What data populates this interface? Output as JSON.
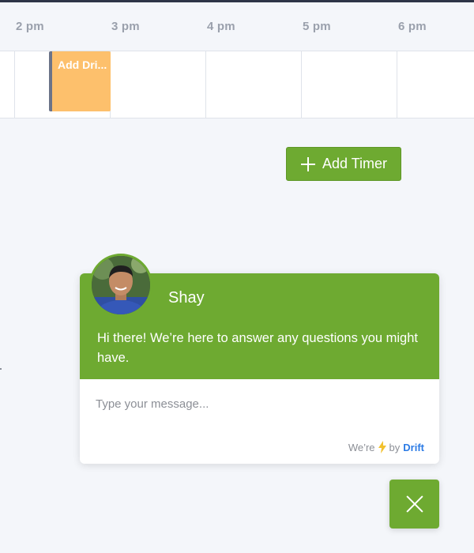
{
  "timeline": {
    "hours": [
      "2 pm",
      "3 pm",
      "4 pm",
      "5 pm",
      "6 pm"
    ],
    "event": {
      "label": "Add Dri...",
      "color": "#fdc06c"
    }
  },
  "toolbar": {
    "add_timer_label": "Add Timer"
  },
  "chat": {
    "agent_name": "Shay",
    "welcome_message": "Hi there! We’re here to answer any questions you might have.",
    "input_placeholder": "Type your message...",
    "powered_prefix": "We’re",
    "powered_by": "by",
    "brand": "Drift"
  },
  "colors": {
    "accent": "#6eaa31",
    "brand_link": "#2c7be5",
    "bolt": "#f2c12e"
  },
  "icons": {
    "add_timer": "plus-icon",
    "powered": "lightning-bolt-icon",
    "close_chat": "close-icon"
  }
}
